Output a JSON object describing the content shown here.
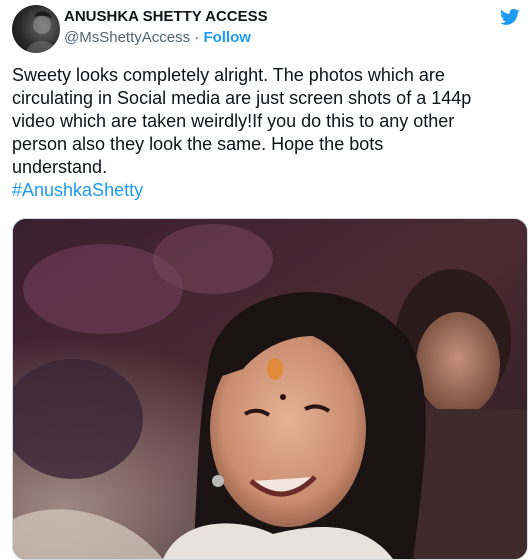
{
  "account": {
    "display_name": "ANUSHKA SHETTY ACCESS",
    "handle": "@MsShettyAccess",
    "separator": " · ",
    "follow_label": "Follow",
    "avatar_icon": "avatar-photo"
  },
  "tweet": {
    "text": "Sweety looks completely alright. The photos which are\ncirculating in Social media are just screen shots of a 144p\nvideo which are taken weirdly!If you do this to any other\nperson also they look the same. Hope the bots\nunderstand.",
    "hashtag": "#AnushkaShetty"
  },
  "icons": {
    "brand": "twitter-bird-icon"
  },
  "colors": {
    "brand_blue": "#1d9bf0",
    "text": "#0f1419",
    "secondary_text": "#536471"
  }
}
